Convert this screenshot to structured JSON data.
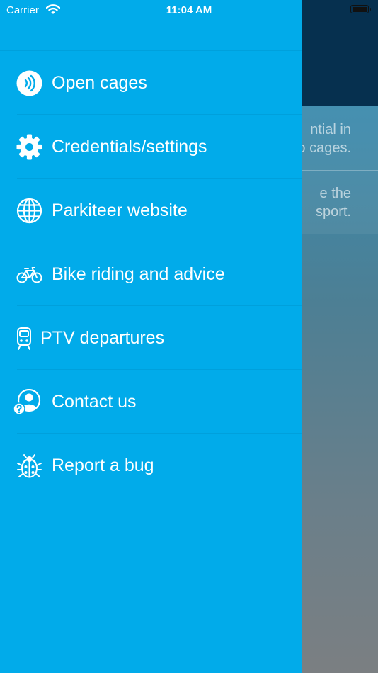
{
  "status_bar": {
    "carrier": "Carrier",
    "time": "11:04 AM"
  },
  "background": {
    "rows": [
      {
        "line1": "ntial in",
        "line2": "o cages."
      },
      {
        "line1": "e the",
        "line2": "sport."
      }
    ]
  },
  "menu": {
    "items": [
      {
        "label": "Open cages",
        "icon": "nfc-tap-icon"
      },
      {
        "label": "Credentials/settings",
        "icon": "gear-icon"
      },
      {
        "label": "Parkiteer website",
        "icon": "globe-icon"
      },
      {
        "label": "Bike riding and advice",
        "icon": "bicycle-icon"
      },
      {
        "label": "PTV departures",
        "icon": "train-icon"
      },
      {
        "label": "Contact us",
        "icon": "contact-help-icon"
      },
      {
        "label": "Report a bug",
        "icon": "bug-icon"
      }
    ]
  },
  "colors": {
    "drawer": "#01abea",
    "header_bg": "#06304f",
    "text": "#ffffff"
  }
}
